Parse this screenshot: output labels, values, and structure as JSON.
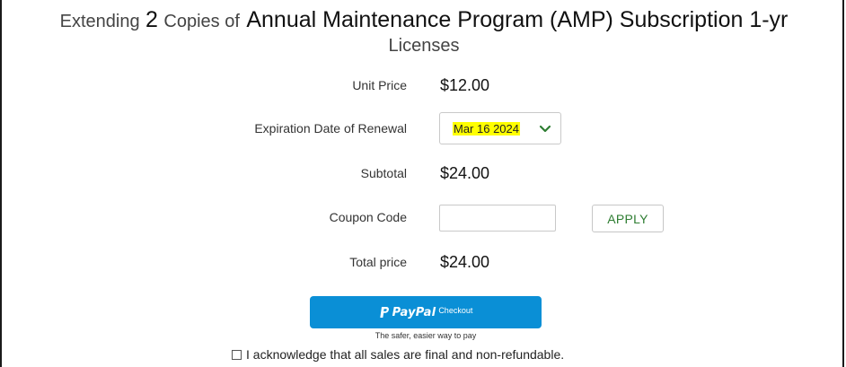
{
  "header": {
    "prefix": "Extending",
    "quantity": "2",
    "copies_of": "Copies of",
    "product": "Annual Maintenance Program (AMP) Subscription 1-yr",
    "suffix": "Licenses"
  },
  "form": {
    "unit_price": {
      "label": "Unit Price",
      "value": "$12.00"
    },
    "expiration": {
      "label": "Expiration Date of Renewal",
      "selected": "Mar 16 2024",
      "highlight_color": "#ffff00",
      "chevron_icon": "chevron-down-icon",
      "chevron_color": "#2e7d32"
    },
    "subtotal": {
      "label": "Subtotal",
      "value": "$24.00"
    },
    "coupon": {
      "label": "Coupon Code",
      "value": "",
      "button": "APPLY"
    },
    "total": {
      "label": "Total price",
      "value": "$24.00"
    }
  },
  "paypal": {
    "brand": "PayPal",
    "checkout": "Checkout",
    "tagline": "The safer, easier way to pay",
    "button_color": "#0a8fd6",
    "icon": "paypal-logo-icon"
  },
  "acknowledgement": {
    "text": "I acknowledge that all sales are final and non-refundable.",
    "checked": false
  }
}
